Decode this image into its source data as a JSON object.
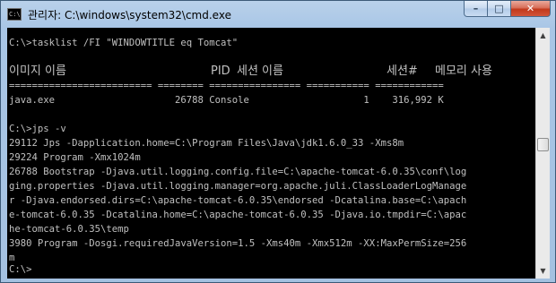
{
  "window": {
    "title": "관리자: C:\\windows\\system32\\cmd.exe",
    "app_icon_text": "C:\\",
    "buttons": {
      "minimize": "–",
      "maximize": "□",
      "close": "✕"
    }
  },
  "console": {
    "lines": [
      "C:\\>tasklist /FI \"WINDOWTITLE eq Tomcat\"",
      "",
      "",
      "========================= ======== ================ =========== ============",
      "java.exe                     26788 Console                    1    316,992 K",
      "",
      "C:\\>jps -v",
      "29112 Jps -Dapplication.home=C:\\Program Files\\Java\\jdk1.6.0_33 -Xms8m",
      "29224 Program -Xmx1024m",
      "26788 Bootstrap -Djava.util.logging.config.file=C:\\apache-tomcat-6.0.35\\conf\\log",
      "ging.properties -Djava.util.logging.manager=org.apache.juli.ClassLoaderLogManage",
      "r -Djava.endorsed.dirs=C:\\apache-tomcat-6.0.35\\endorsed -Dcatalina.base=C:\\apach",
      "e-tomcat-6.0.35 -Dcatalina.home=C:\\apache-tomcat-6.0.35 -Djava.io.tmpdir=C:\\apac",
      "he-tomcat-6.0.35\\temp",
      "3980 Program -Dosgi.requiredJavaVersion=1.5 -Xms40m -Xmx512m -XX:MaxPermSize=256",
      "m",
      "",
      "C:\\>"
    ],
    "header": {
      "image_name": "이미지 이름",
      "pid": "PID",
      "session_name": "세션 이름",
      "session_num": "세션#",
      "mem_usage": "메모리 사용"
    }
  },
  "scrollbar": {
    "up": "▲",
    "down": "▼"
  }
}
